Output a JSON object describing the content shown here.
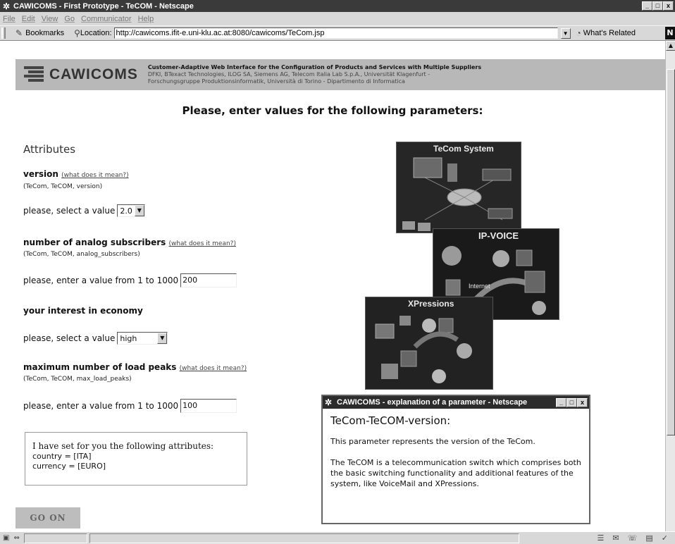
{
  "window": {
    "title": "CAWICOMS - First Prototype - TeCOM - Netscape",
    "buttons": [
      "_",
      "□",
      "x"
    ]
  },
  "menu": [
    "File",
    "Edit",
    "View",
    "Go",
    "Communicator",
    "Help"
  ],
  "toolbar": {
    "bookmarks_label": "Bookmarks",
    "location_label": "Location:",
    "url": "http://cawicoms.ifit-e.uni-klu.ac.at:8080/cawicoms/TeCom.jsp",
    "related_label": "What's Related"
  },
  "banner": {
    "logo": "CAWICOMS",
    "line1": "Customer-Adaptive Web Interface for the Configuration of Products and Services with Multiple Suppliers",
    "line2": "DFKI, BTexact Technologies, ILOG SA, Siemens AG, Telecom Italia Lab S.p.A., Universität Klagenfurt -",
    "line3": "Forschungsgruppe Produktionsinformatik, Università di Torino - Dipartimento di Informatica"
  },
  "main": {
    "heading": "Please, enter values for the following parameters:",
    "attributes_title": "Attributes",
    "params": [
      {
        "name": "version",
        "link": "(what does it mean?)",
        "path": "(TeCom, TeCOM, version)",
        "prompt": "please, select a value",
        "value": "2.0"
      },
      {
        "name": "number of analog subscribers",
        "link": "(what does it mean?)",
        "path": "(TeCom, TeCOM, analog_subscribers)",
        "prompt": "please, enter a value from 1 to 1000",
        "value": "200"
      },
      {
        "name": "your interest in economy",
        "prompt": "please, select a value",
        "value": "high"
      },
      {
        "name": "maximum number of load peaks",
        "link": "(what does it mean?)",
        "path": "(TeCom, TeCOM, max_load_peaks)",
        "prompt": "please, enter a value from 1 to 1000",
        "value": "100"
      }
    ],
    "info": {
      "head": "I have set for you the following attributes:",
      "line1": "country = [ITA]",
      "line2": "currency = [EURO]"
    },
    "go_on": "GO ON"
  },
  "illustration": {
    "panel1": "TeCom System",
    "panel2": "IP-VOICE",
    "panel2_sub": "Internet",
    "panel3": "XPressions"
  },
  "popup": {
    "title": "CAWICOMS - explanation of a parameter - Netscape",
    "heading": "TeCom-TeCOM-version:",
    "p1": "This parameter represents the version of the TeCom.",
    "p2": "The TeCOM is a telecommunication switch which comprises both the basic switching functionality and additional features of the system, like VoiceMail and XPressions."
  }
}
